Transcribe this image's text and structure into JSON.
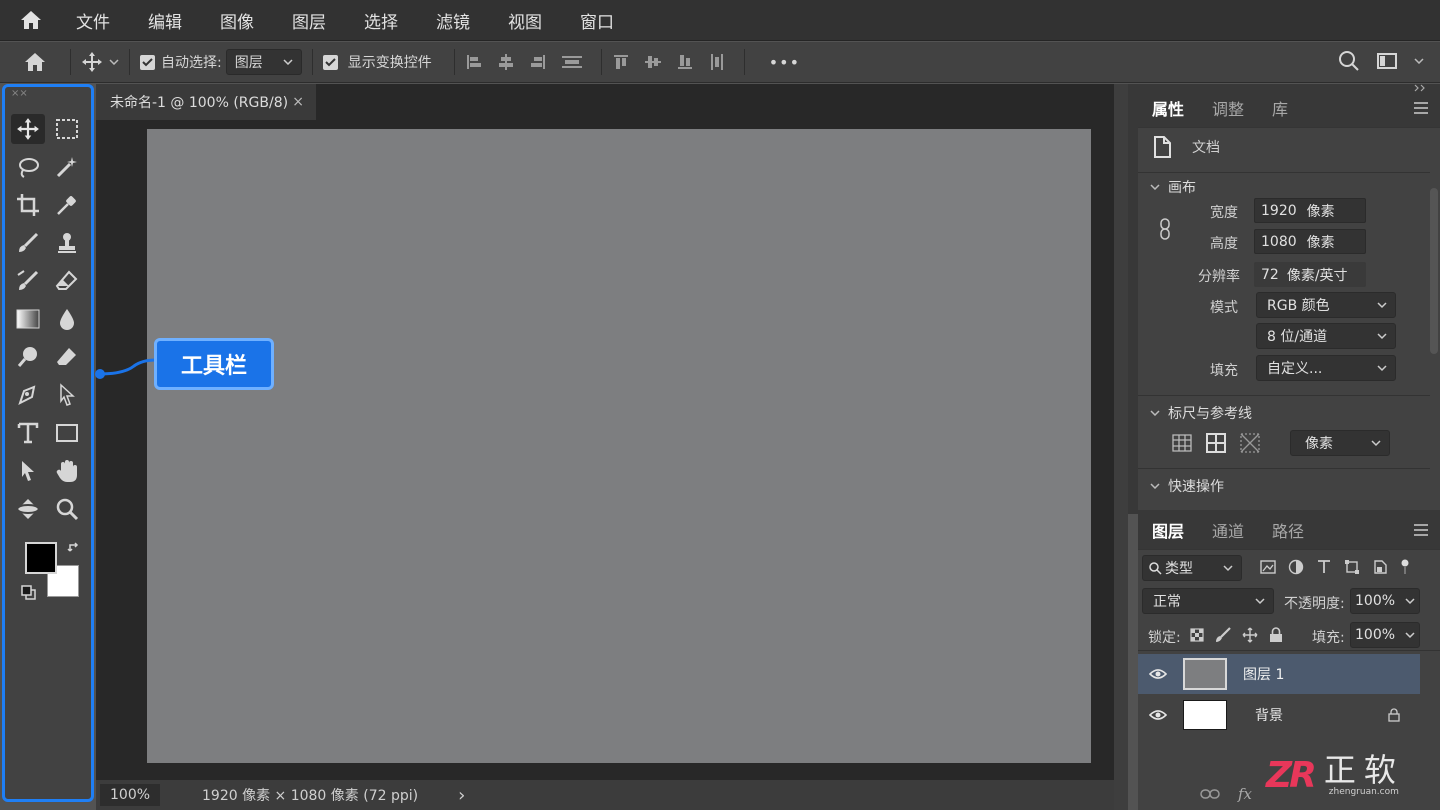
{
  "menubar": {
    "items": [
      "文件",
      "编辑",
      "图像",
      "图层",
      "选择",
      "滤镜",
      "视图",
      "窗口"
    ]
  },
  "options": {
    "auto_select_label": "自动选择:",
    "auto_select_value": "图层",
    "show_transform_label": "显示变换控件",
    "more": "•••"
  },
  "toolbar": {
    "callout": "工具栏",
    "collapse": "××"
  },
  "document": {
    "tab_title": "未命名-1 @ 100% (RGB/8)",
    "tab_close": "×",
    "canvas_color": "#7d7e80",
    "zoom": "100%",
    "info": "1920 像素 × 1080 像素 (72 ppi)",
    "arrow": "›"
  },
  "properties": {
    "tabs": [
      "属性",
      "调整",
      "库"
    ],
    "doc_label": "文档",
    "canvas_section": "画布",
    "width_label": "宽度",
    "width_value": "1920",
    "width_unit": "像素",
    "height_label": "高度",
    "height_value": "1080",
    "height_unit": "像素",
    "resolution_label": "分辨率",
    "resolution_value": "72",
    "resolution_unit": "像素/英寸",
    "mode_label": "模式",
    "mode_value": "RGB 颜色",
    "depth_value": "8 位/通道",
    "fill_label": "填充",
    "fill_value": "自定义...",
    "rulers_section": "标尺与参考线",
    "rulers_unit": "像素",
    "quick_section": "快速操作"
  },
  "layers": {
    "tabs": [
      "图层",
      "通道",
      "路径"
    ],
    "filter_value": "类型",
    "blend_mode": "正常",
    "opacity_label": "不透明度:",
    "opacity_value": "100%",
    "lock_label": "锁定:",
    "fill_label": "填充:",
    "fill_value": "100%",
    "items": [
      {
        "name": "图层 1",
        "selected": true,
        "thumb": "#7d7e80"
      },
      {
        "name": "背景",
        "selected": false,
        "thumb": "#ffffff"
      }
    ]
  },
  "watermark": {
    "logo": "ZR",
    "text": "正软",
    "url": "zhengruan.com"
  },
  "colors": {
    "accent": "#1f7ff5",
    "selected_layer": "#4c5a6e"
  }
}
